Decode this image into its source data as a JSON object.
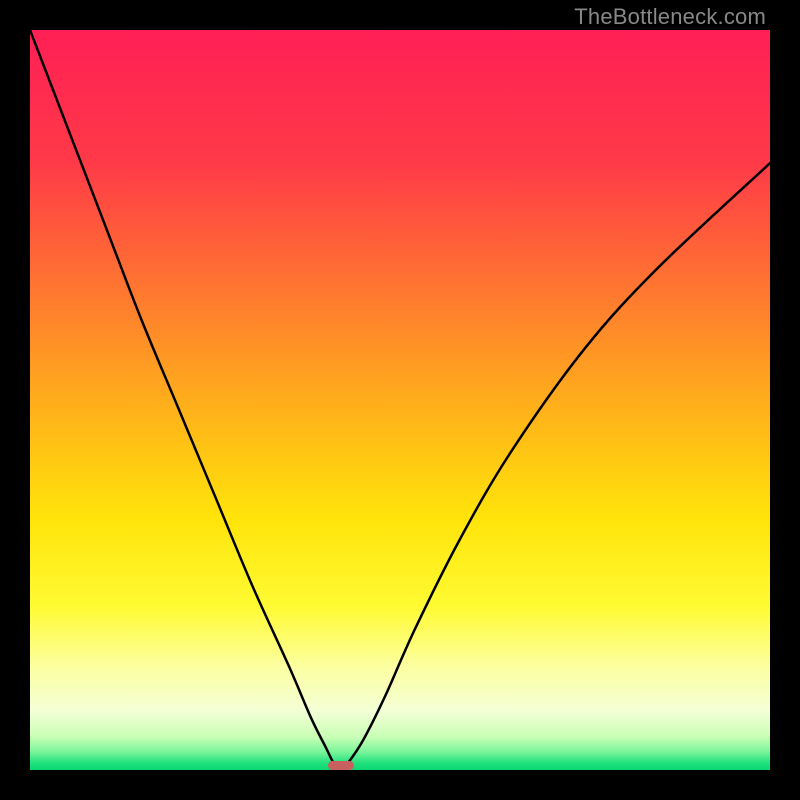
{
  "watermark": {
    "text": "TheBottleneck.com"
  },
  "chart_data": {
    "type": "line",
    "title": "",
    "xlabel": "",
    "ylabel": "",
    "xlim": [
      0,
      100
    ],
    "ylim": [
      0,
      100
    ],
    "x": [
      0,
      5,
      10,
      15,
      20,
      25,
      30,
      35,
      38,
      40,
      41,
      42,
      43,
      45,
      48,
      52,
      58,
      65,
      75,
      85,
      100
    ],
    "values": [
      100,
      87,
      74,
      61,
      49,
      37,
      25,
      14,
      7,
      3,
      1,
      0,
      1,
      4,
      10,
      19,
      31,
      43,
      57,
      68,
      82
    ],
    "optimum_x": 42,
    "optimum_y": 0,
    "gradient_stops": [
      {
        "offset": 0.0,
        "color": "#ff1f55"
      },
      {
        "offset": 0.18,
        "color": "#ff3a48"
      },
      {
        "offset": 0.36,
        "color": "#ff7a2f"
      },
      {
        "offset": 0.52,
        "color": "#ffb419"
      },
      {
        "offset": 0.66,
        "color": "#ffe40a"
      },
      {
        "offset": 0.78,
        "color": "#fffb33"
      },
      {
        "offset": 0.86,
        "color": "#fcffa0"
      },
      {
        "offset": 0.92,
        "color": "#f4ffd6"
      },
      {
        "offset": 0.955,
        "color": "#c9ffb5"
      },
      {
        "offset": 0.975,
        "color": "#7cf59a"
      },
      {
        "offset": 0.99,
        "color": "#22e27e"
      },
      {
        "offset": 1.0,
        "color": "#09d873"
      }
    ],
    "marker": {
      "color": "#c96060",
      "width_pct": 3.5,
      "height_pct": 1.2
    }
  }
}
